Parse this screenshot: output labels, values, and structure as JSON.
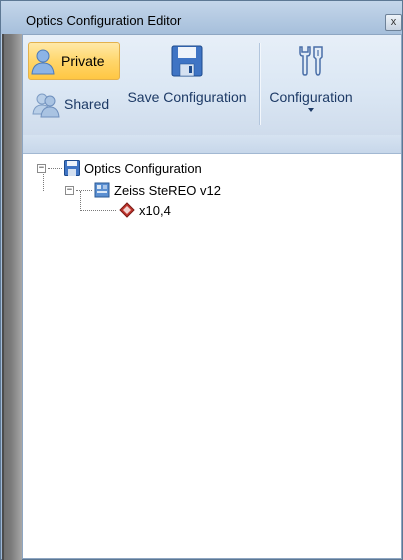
{
  "window": {
    "title": "Optics Configuration Editor",
    "close_label": "x"
  },
  "toolbar": {
    "private_label": "Private",
    "shared_label": "Shared",
    "save_label": "Save Configuration",
    "config_label": "Configuration"
  },
  "tree": {
    "root": {
      "label": "Optics Configuration",
      "icon": "disk-icon",
      "expanded": true
    },
    "child": {
      "label": "Zeiss SteREO v12",
      "icon": "microscope-icon",
      "expanded": true
    },
    "leaf": {
      "label": "x10,4",
      "icon": "lens-icon"
    }
  },
  "colors": {
    "selected_button": "#ffd66b",
    "toolbar_text": "#1d3a66",
    "lens_red": "#c0352d"
  }
}
